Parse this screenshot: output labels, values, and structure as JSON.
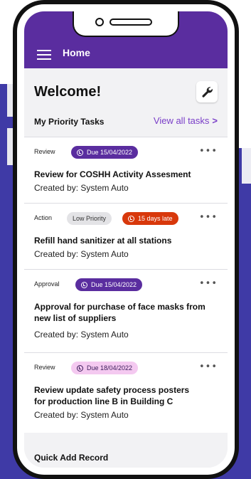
{
  "appbar": {
    "title": "Home"
  },
  "welcome": "Welcome!",
  "priority": {
    "title": "My Priority Tasks",
    "view_all": "View all tasks",
    "chevron": ">"
  },
  "tasks": [
    {
      "type": "Review",
      "due": "Due 15/04/2022",
      "title": "Review for COSHH Activity Assesment",
      "created": "Created by: System Auto",
      "more": "•••"
    },
    {
      "type": "Action",
      "priority": "Low Priority",
      "late": "15 days late",
      "title": "Refill hand sanitizer at all stations",
      "created": "Created by: System Auto",
      "more": "•••"
    },
    {
      "type": "Approval",
      "due": "Due 15/04/2022",
      "title_line1": "Approval for purchase of face masks from",
      "title_line2": "new list of suppliers",
      "created": "Created by: System Auto",
      "more": "•••"
    },
    {
      "type": "Review",
      "due": "Due 18/04/2022",
      "title_line1": "Review update safety process posters",
      "title_line2": "for production line B in Building C",
      "created": "Created by: System Auto",
      "more": "•••"
    }
  ],
  "quick_add": "Quick Add Record",
  "colors": {
    "brand_purple": "#5a2d9f",
    "accent_link": "#7a3ec8",
    "late_red": "#d8380b",
    "due_pink": "#f4c9f0",
    "background_band": "#3f3aa6"
  },
  "icons": [
    "menu-icon",
    "wrench-icon",
    "chevron-right-icon",
    "clock-icon",
    "more-icon"
  ]
}
